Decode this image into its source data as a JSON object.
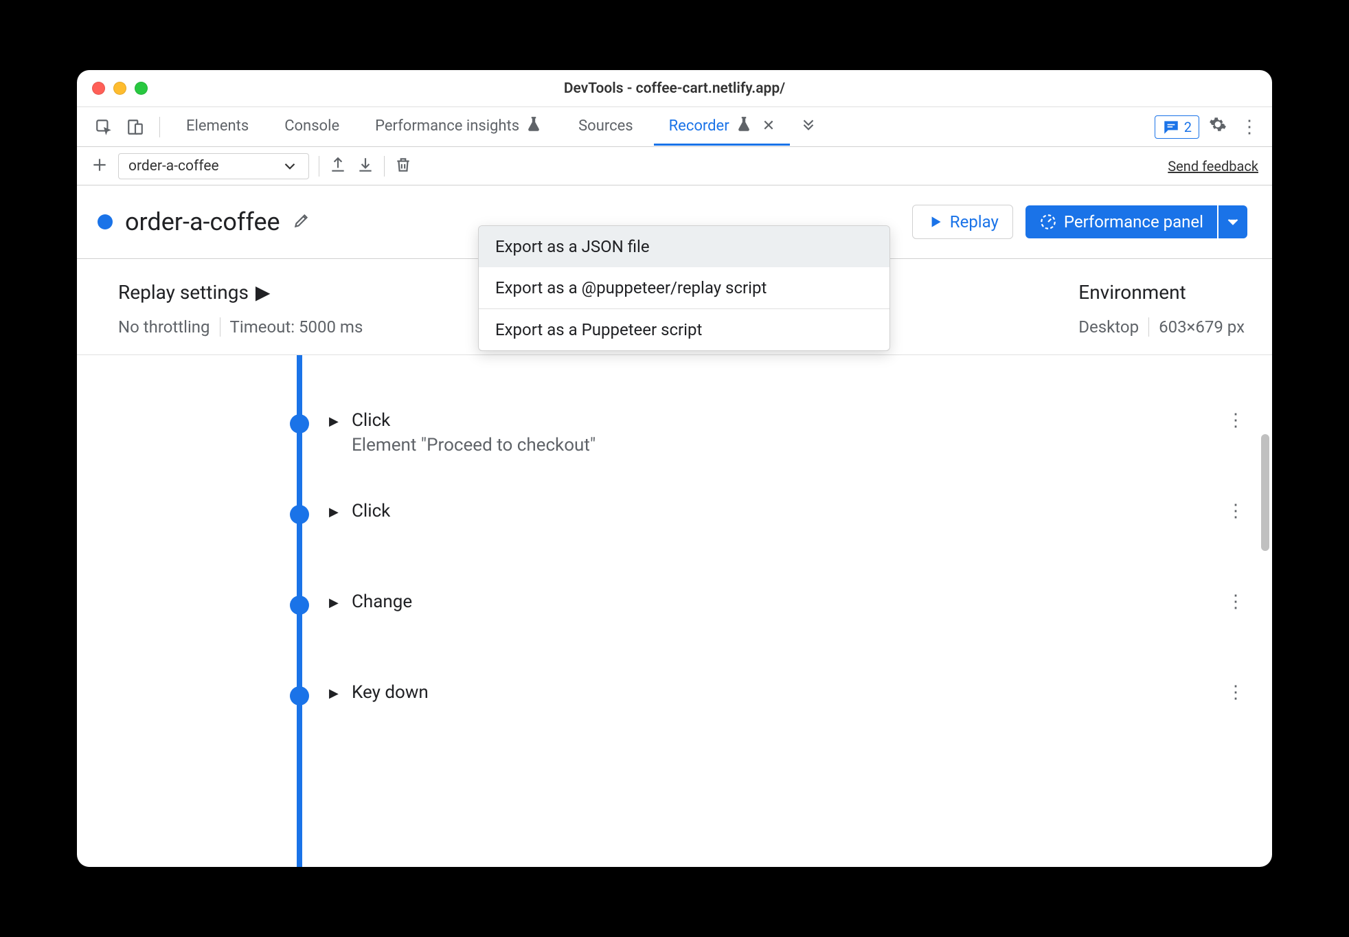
{
  "window": {
    "title": "DevTools - coffee-cart.netlify.app/"
  },
  "tabs": {
    "elements": "Elements",
    "console": "Console",
    "perf_insights": "Performance insights",
    "sources": "Sources",
    "recorder": "Recorder"
  },
  "comments_count": "2",
  "recording_select": "order-a-coffee",
  "feedback": "Send feedback",
  "recording_title": "order-a-coffee",
  "replay_label": "Replay",
  "perf_panel_label": "Performance panel",
  "export_menu": {
    "json": "Export as a JSON file",
    "puppeteer_replay": "Export as a @puppeteer/replay script",
    "puppeteer": "Export as a Puppeteer script"
  },
  "settings": {
    "replay_header": "Replay settings",
    "throttling": "No throttling",
    "timeout": "Timeout: 5000 ms",
    "env_header": "Environment",
    "device": "Desktop",
    "dimensions": "603×679 px"
  },
  "steps": [
    {
      "label": "Click",
      "sub": "Element \"Proceed to checkout\""
    },
    {
      "label": "Click",
      "sub": ""
    },
    {
      "label": "Change",
      "sub": ""
    },
    {
      "label": "Key down",
      "sub": ""
    }
  ]
}
